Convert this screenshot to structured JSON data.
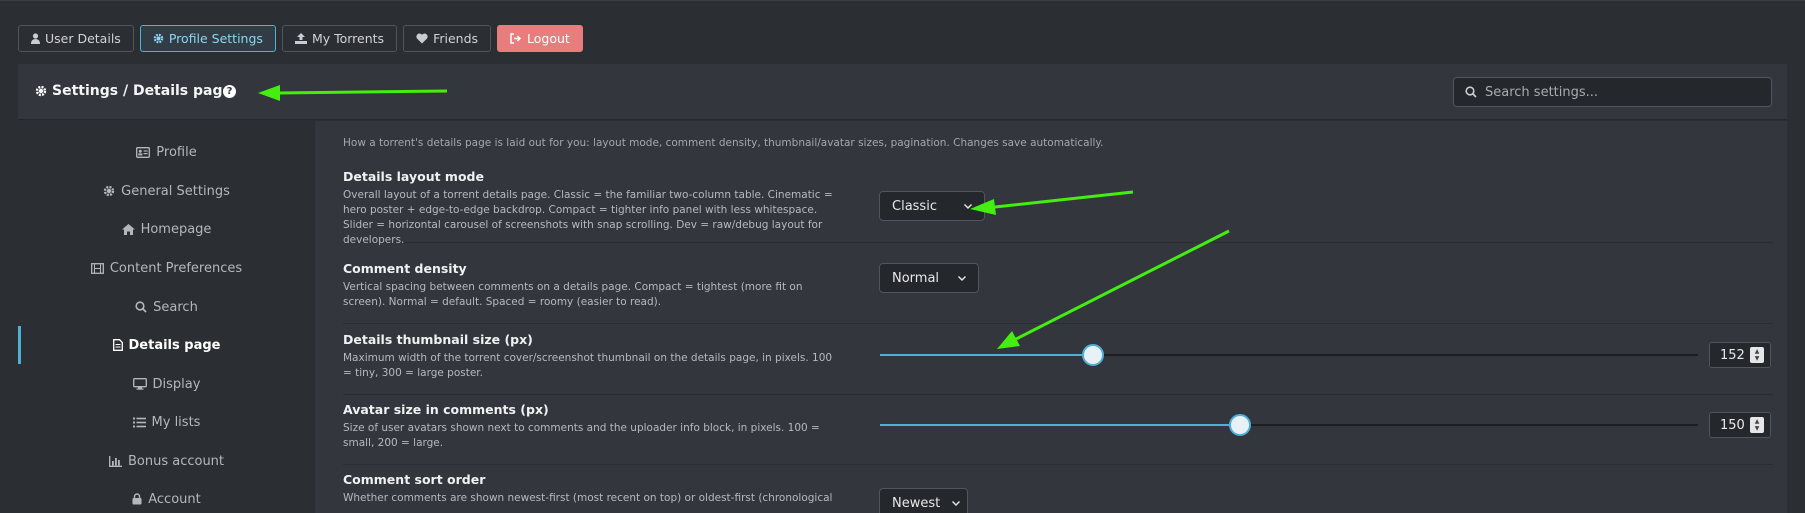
{
  "tabs": [
    {
      "label": "User Details",
      "icon": "user-icon"
    },
    {
      "label": "Profile Settings",
      "icon": "gear-icon",
      "active": true
    },
    {
      "label": "My Torrents",
      "icon": "upload-icon"
    },
    {
      "label": "Friends",
      "icon": "heart-icon"
    },
    {
      "label": "Logout",
      "icon": "logout-icon"
    }
  ],
  "header": {
    "title": "Settings / Details page",
    "help_glyph": "?",
    "search_placeholder": "Search settings..."
  },
  "sidebar": {
    "items": [
      {
        "label": "Profile",
        "icon": "id-card-icon"
      },
      {
        "label": "General Settings",
        "icon": "gear-icon"
      },
      {
        "label": "Homepage",
        "icon": "home-icon"
      },
      {
        "label": "Content Preferences",
        "icon": "film-icon"
      },
      {
        "label": "Search",
        "icon": "search-icon"
      },
      {
        "label": "Details page",
        "icon": "file-icon",
        "active": true
      },
      {
        "label": "Display",
        "icon": "monitor-icon"
      },
      {
        "label": "My lists",
        "icon": "list-icon"
      },
      {
        "label": "Bonus account",
        "icon": "bar-chart-icon"
      },
      {
        "label": "Account",
        "icon": "lock-icon"
      }
    ]
  },
  "main": {
    "intro": "How a torrent's details page is laid out for you: layout mode, comment density, thumbnail/avatar sizes, pagination. Changes save automatically.",
    "settings": {
      "layout_mode": {
        "title": "Details layout mode",
        "description": "Overall layout of a torrent details page. Classic = the familiar two-column table. Cinematic = hero poster + edge-to-edge backdrop. Compact = tighter info panel with less whitespace. Slider = horizontal carousel of screenshots with snap scrolling. Dev = raw/debug layout for developers.",
        "value": "Classic"
      },
      "comment_density": {
        "title": "Comment density",
        "description": "Vertical spacing between comments on a details page. Compact = tightest (more fit on screen). Normal = default. Spaced = roomy (easier to read).",
        "value": "Normal"
      },
      "thumbnail_size": {
        "title": "Details thumbnail size (px)",
        "description": "Maximum width of the torrent cover/screenshot thumbnail on the details page, in pixels. 100 = tiny, 300 = large poster.",
        "value": "152",
        "level": 0.26
      },
      "avatar_size": {
        "title": "Avatar size in comments (px)",
        "description": "Size of user avatars shown next to comments and the uploader info block, in pixels. 100 = small, 200 = large.",
        "value": "150",
        "level": 0.44
      },
      "sort_order": {
        "title": "Comment sort order",
        "description": "Whether comments are shown newest-first (most recent on top) or oldest-first (chronological",
        "value": "Newest"
      }
    }
  },
  "colors": {
    "background": "#2b2e33",
    "panel": "#33363c",
    "accent": "#4fb0d6",
    "logout": "#e77d7d",
    "annotation_arrow": "#44ee11"
  }
}
